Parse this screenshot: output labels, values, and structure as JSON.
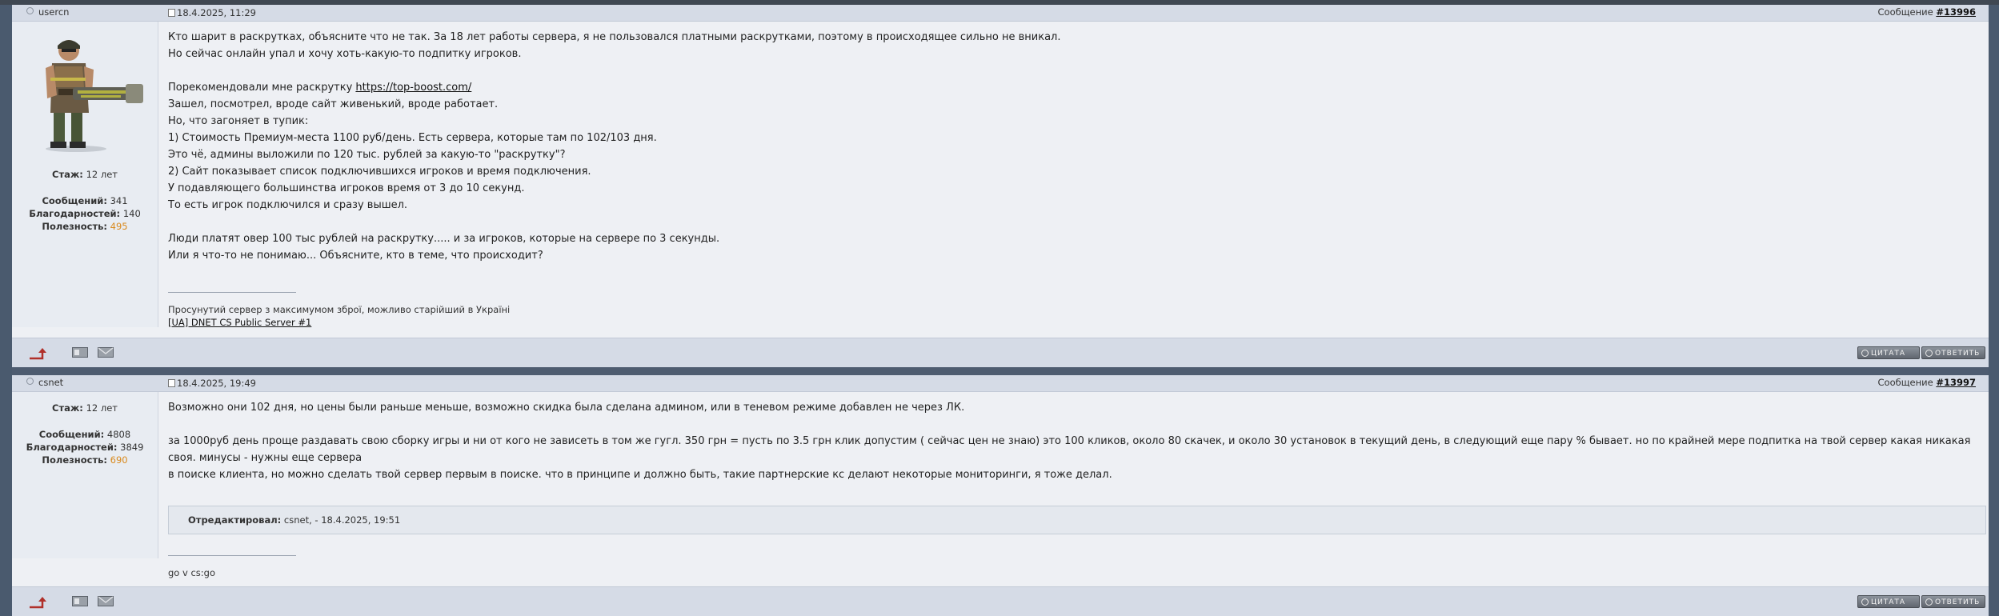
{
  "posts": [
    {
      "author": "usercn",
      "time": "18.4.2025, 11:29",
      "message_prefix": "Сообщение",
      "message_id": "#13996",
      "stats": {
        "tenure_label": "Стаж:",
        "tenure": "12 лет",
        "messages_label": "Сообщений:",
        "messages": "341",
        "thanks_label": "Благодарностей:",
        "thanks": "140",
        "useful_label": "Полезность:",
        "useful": "495"
      },
      "body": {
        "l1": "Кто шарит в раскрутках, объясните что не так. За 18 лет работы сервера, я не пользовался платными раскрутками, поэтому в происходящее сильно не вникал.",
        "l2": "Но сейчас онлайн упал и хочу хоть-какую-то подпитку игроков.",
        "l3_text": "Порекомендовали мне раскрутку ",
        "l3_link": "https://top-boost.com/",
        "l4": "Зашел, посмотрел, вроде сайт живенький, вроде работает.",
        "l5": "Но, что загоняет в тупик:",
        "l6": "1) Стоимость Премиум-места 1100 руб/день. Есть сервера, которые там по 102/103 дня.",
        "l7": "Это чё, админы выложили по 120 тыс. рублей за какую-то \"раскрутку\"?",
        "l8": "2) Сайт показывает список подключившихся игроков и время подключения.",
        "l9": "У подавляющего большинства игроков время от 3 до 10 секунд.",
        "l10": "То есть игрок подключился и сразу вышел.",
        "l11": "Люди платят овер 100 тыс рублей на раскрутку..... и за игроков, которые на сервере по 3 секунды.",
        "l12": "Или я что-то не понимаю... Объясните, кто в теме, что происходит?"
      },
      "signature": {
        "line1": "Просунутий сервер з максимумом зброї, можливо старійший в Україні",
        "link": "[UA] DNET CS Public Server #1"
      }
    },
    {
      "author": "csnet",
      "time": "18.4.2025, 19:49",
      "message_prefix": "Сообщение",
      "message_id": "#13997",
      "stats": {
        "tenure_label": "Стаж:",
        "tenure": "12 лет",
        "messages_label": "Сообщений:",
        "messages": "4808",
        "thanks_label": "Благодарностей:",
        "thanks": "3849",
        "useful_label": "Полезность:",
        "useful": "690"
      },
      "body": {
        "l1": "Возможно они 102 дня, но цены были раньше меньше, возможно скидка была сделана админом, или в теневом режиме добавлен не через ЛК.",
        "l2": "за 1000руб день проще раздавать свою сборку игры и ни от кого не зависеть в том же гугл. 350 грн = пусть по 3.5 грн клик допустим ( сейчас цен не знаю) это 100 кликов, около 80 скачек, и около 30 установок в текущий день, в следующий еще пару % бывает. но по крайней мере подпитка на твой сервер какая никакая своя. минусы - нужны еще сервера",
        "l3": "в поиске клиента, но можно сделать твой сервер первым в поиске. что в принципе и должно быть, такие партнерские кс делают некоторые мониторинги, я тоже делал."
      },
      "edited_label": "Отредактировал:",
      "edited_text": "csnet, - 18.4.2025, 19:51",
      "signature": {
        "line1": "go v cs:go"
      }
    }
  ],
  "buttons": {
    "quote": "цитата",
    "reply": "ответить"
  },
  "colors": {
    "useful": "#d98a1e",
    "header_bg": "#d5dbe6",
    "page_bg": "#4a5a6e"
  },
  "icons": {
    "up": "up-arrow-icon",
    "profile": "profile-card-icon",
    "mail": "mail-icon"
  }
}
